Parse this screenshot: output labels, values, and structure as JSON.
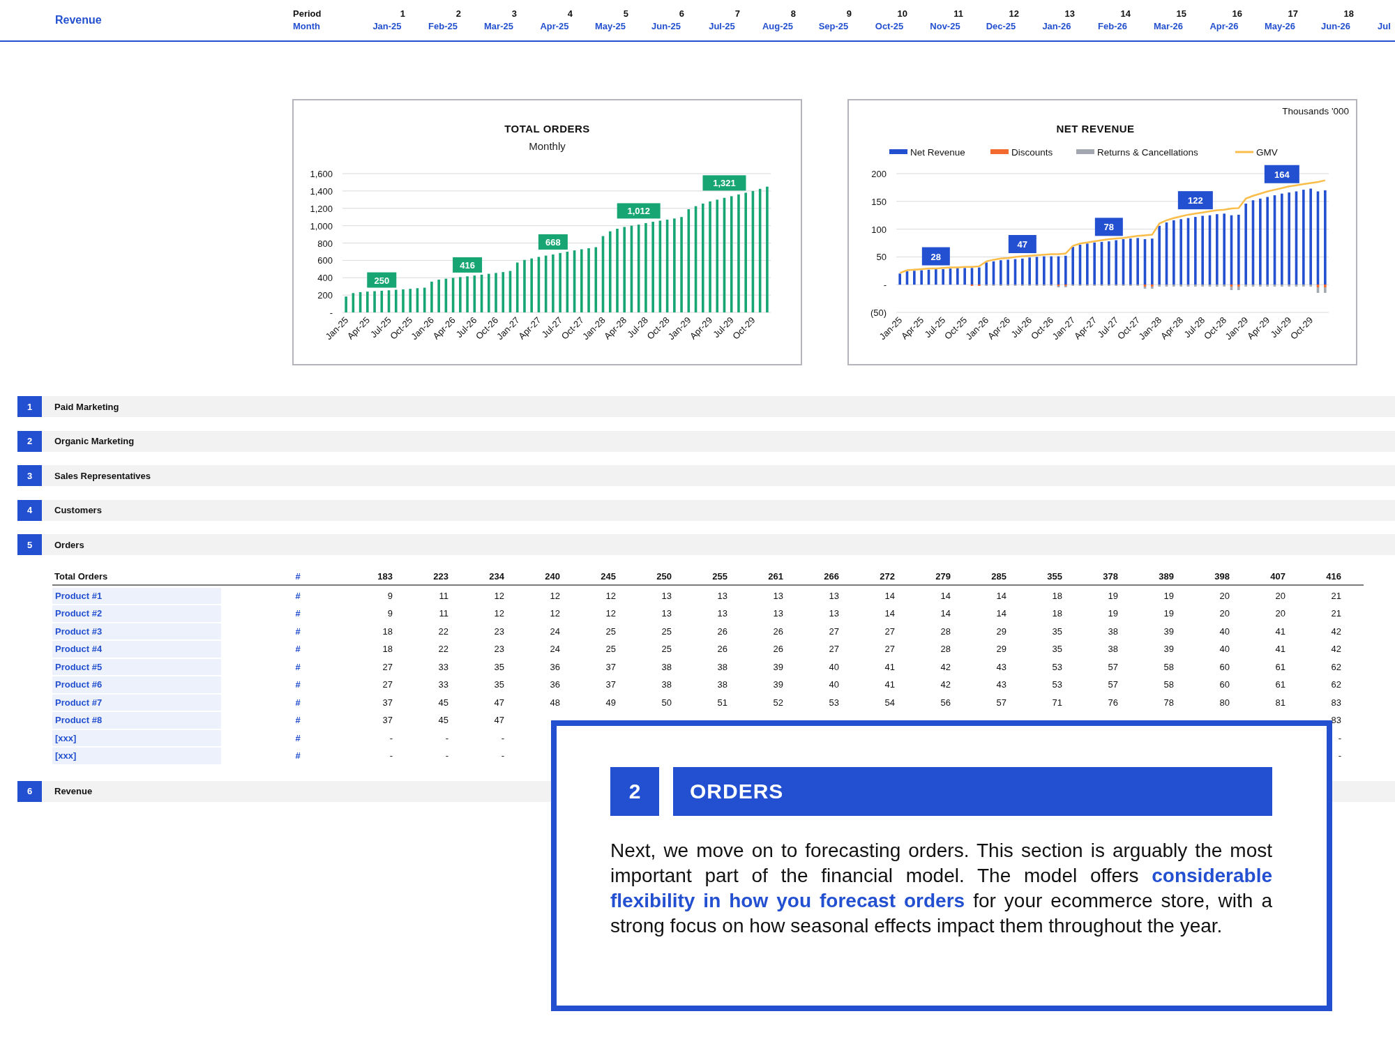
{
  "header": {
    "title": "Revenue",
    "period_label": "Period",
    "month_label": "Month",
    "periods": [
      {
        "number": "1",
        "month": "Jan-25"
      },
      {
        "number": "2",
        "month": "Feb-25"
      },
      {
        "number": "3",
        "month": "Mar-25"
      },
      {
        "number": "4",
        "month": "Apr-25"
      },
      {
        "number": "5",
        "month": "May-25"
      },
      {
        "number": "6",
        "month": "Jun-25"
      },
      {
        "number": "7",
        "month": "Jul-25"
      },
      {
        "number": "8",
        "month": "Aug-25"
      },
      {
        "number": "9",
        "month": "Sep-25"
      },
      {
        "number": "10",
        "month": "Oct-25"
      },
      {
        "number": "11",
        "month": "Nov-25"
      },
      {
        "number": "12",
        "month": "Dec-25"
      },
      {
        "number": "13",
        "month": "Jan-26"
      },
      {
        "number": "14",
        "month": "Feb-26"
      },
      {
        "number": "15",
        "month": "Mar-26"
      },
      {
        "number": "16",
        "month": "Apr-26"
      },
      {
        "number": "17",
        "month": "May-26"
      },
      {
        "number": "18",
        "month": "Jun-26"
      }
    ],
    "cut_month": "Jul"
  },
  "charts": [
    {
      "chart_data": {
        "type": "bar",
        "title": "TOTAL ORDERS",
        "subtitle": "Monthly",
        "grid": true,
        "color": "#17a673",
        "categories": [
          "Jan-25",
          null,
          null,
          "Apr-25",
          null,
          null,
          "Jul-25",
          null,
          null,
          "Oct-25",
          null,
          null,
          "Jan-26",
          null,
          null,
          "Apr-26",
          null,
          null,
          "Jul-26",
          null,
          null,
          "Oct-26",
          null,
          null,
          "Jan-27",
          null,
          null,
          "Apr-27",
          null,
          null,
          "Jul-27",
          null,
          null,
          "Oct-27",
          null,
          null,
          "Jan-28",
          null,
          null,
          "Apr-28",
          null,
          null,
          "Jul-28",
          null,
          null,
          "Oct-28",
          null,
          null,
          "Jan-29",
          null,
          null,
          "Apr-29",
          null,
          null,
          "Jul-29",
          null,
          null,
          "Oct-29",
          null,
          null
        ],
        "values": [
          183,
          223,
          234,
          240,
          245,
          250,
          255,
          261,
          266,
          272,
          279,
          285,
          355,
          378,
          389,
          398,
          407,
          416,
          425,
          435,
          445,
          455,
          465,
          478,
          575,
          605,
          622,
          640,
          655,
          668,
          685,
          700,
          715,
          728,
          740,
          752,
          880,
          935,
          965,
          985,
          1000,
          1012,
          1030,
          1045,
          1058,
          1070,
          1083,
          1100,
          1190,
          1225,
          1255,
          1280,
          1300,
          1321,
          1340,
          1360,
          1380,
          1400,
          1425,
          1450
        ],
        "ylim": [
          0,
          1600
        ],
        "yticks": [
          {
            "value": 0,
            "label": "-"
          },
          {
            "value": 200,
            "label": "200"
          },
          {
            "value": 400,
            "label": "400"
          },
          {
            "value": 600,
            "label": "600"
          },
          {
            "value": 800,
            "label": "800"
          },
          {
            "value": 1000,
            "label": "1,000"
          },
          {
            "value": 1200,
            "label": "1,200"
          },
          {
            "value": 1400,
            "label": "1,400"
          },
          {
            "value": 1600,
            "label": "1,600"
          }
        ],
        "value_labels": [
          null,
          null,
          null,
          null,
          null,
          "250",
          null,
          null,
          null,
          null,
          null,
          null,
          null,
          null,
          null,
          null,
          null,
          "416",
          null,
          null,
          null,
          null,
          null,
          null,
          null,
          null,
          null,
          null,
          null,
          "668",
          null,
          null,
          null,
          null,
          null,
          null,
          null,
          null,
          null,
          null,
          null,
          "1,012",
          null,
          null,
          null,
          null,
          null,
          null,
          null,
          null,
          null,
          null,
          null,
          "1,321",
          null,
          null,
          null,
          null,
          null,
          null
        ]
      }
    },
    {
      "chart_data": {
        "type": "bar",
        "title": "NET REVENUE",
        "ylabel": "Thousands '000",
        "stacked": true,
        "grid": true,
        "legend": true,
        "categories": [
          "Jan-25",
          null,
          null,
          "Apr-25",
          null,
          null,
          "Jul-25",
          null,
          null,
          "Oct-25",
          null,
          null,
          "Jan-26",
          null,
          null,
          "Apr-26",
          null,
          null,
          "Jul-26",
          null,
          null,
          "Oct-26",
          null,
          null,
          "Jan-27",
          null,
          null,
          "Apr-27",
          null,
          null,
          "Jul-27",
          null,
          null,
          "Oct-27",
          null,
          null,
          "Jan-28",
          null,
          null,
          "Apr-28",
          null,
          null,
          "Jul-28",
          null,
          null,
          "Oct-28",
          null,
          null,
          "Jan-29",
          null,
          null,
          "Apr-29",
          null,
          null,
          "Jul-29",
          null,
          null,
          "Oct-29",
          null,
          null
        ],
        "series": [
          {
            "name": "Net Revenue",
            "color": "#2350d0",
            "type": "bar",
            "values": [
              20,
              24,
              25,
              26,
              27,
              28,
              28,
              29,
              30,
              30,
              30,
              31,
              40,
              42,
              44,
              45,
              46,
              47,
              49,
              50,
              51,
              51,
              51,
              52,
              68,
              72,
              74,
              76,
              77,
              78,
              80,
              82,
              83,
              84,
              82,
              83,
              106,
              112,
              116,
              118,
              120,
              122,
              124,
              125,
              127,
              128,
              125,
              126,
              146,
              152,
              155,
              158,
              161,
              164,
              166,
              168,
              171,
              173,
              168,
              170
            ]
          },
          {
            "name": "Discounts",
            "color": "#f26a2e",
            "type": "bar",
            "values": [
              0,
              0,
              0,
              0,
              0,
              0,
              0,
              0,
              0,
              0,
              -1,
              -1,
              0,
              0,
              0,
              0,
              0,
              0,
              0,
              0,
              0,
              0,
              -2,
              -2,
              0,
              0,
              0,
              0,
              0,
              0,
              0,
              0,
              0,
              0,
              -3,
              -3,
              0,
              0,
              0,
              0,
              0,
              0,
              0,
              0,
              0,
              0,
              -4,
              -4,
              0,
              0,
              0,
              0,
              0,
              0,
              0,
              0,
              0,
              0,
              -5,
              -5
            ]
          },
          {
            "name": "Returns & Cancellations",
            "color": "#a3a7b0",
            "type": "bar",
            "values": [
              0,
              0,
              0,
              0,
              0,
              0,
              0,
              0,
              0,
              0,
              0,
              0,
              -1,
              -1,
              -1,
              -1,
              -1,
              -1,
              -1,
              -1,
              -1,
              -1,
              -1,
              -1,
              -2,
              -2,
              -2,
              -2,
              -2,
              -2,
              -2,
              -2,
              -2,
              -2,
              -4,
              -4,
              -3,
              -3,
              -3,
              -3,
              -3,
              -3,
              -3,
              -3,
              -3,
              -3,
              -6,
              -6,
              -4,
              -4,
              -4,
              -4,
              -4,
              -4,
              -4,
              -4,
              -4,
              -4,
              -10,
              -10
            ]
          },
          {
            "name": "GMV",
            "color": "#fbbd4a",
            "type": "line",
            "values": [
              21,
              26,
              27,
              28,
              29,
              29,
              30,
              31,
              31,
              32,
              32,
              33,
              42,
              45,
              47,
              48,
              50,
              51,
              52,
              53,
              54,
              55,
              55,
              56,
              70,
              74,
              76,
              78,
              80,
              82,
              83,
              84,
              86,
              88,
              89,
              90,
              110,
              116,
              120,
              123,
              126,
              128,
              130,
              132,
              134,
              135,
              137,
              138,
              155,
              160,
              164,
              168,
              171,
              174,
              177,
              179,
              181,
              183,
              185,
              188
            ]
          }
        ],
        "ylim": [
          -50,
          200
        ],
        "yticks": [
          {
            "value": -50,
            "label": "(50)"
          },
          {
            "value": 0,
            "label": "-"
          },
          {
            "value": 50,
            "label": "50"
          },
          {
            "value": 100,
            "label": "100"
          },
          {
            "value": 150,
            "label": "150"
          },
          {
            "value": 200,
            "label": "200"
          }
        ],
        "value_labels": [
          null,
          null,
          null,
          null,
          null,
          "28",
          null,
          null,
          null,
          null,
          null,
          null,
          null,
          null,
          null,
          null,
          null,
          "47",
          null,
          null,
          null,
          null,
          null,
          null,
          null,
          null,
          null,
          null,
          null,
          "78",
          null,
          null,
          null,
          null,
          null,
          null,
          null,
          null,
          null,
          null,
          null,
          "122",
          null,
          null,
          null,
          null,
          null,
          null,
          null,
          null,
          null,
          null,
          null,
          "164",
          null,
          null,
          null,
          null,
          null,
          null
        ]
      }
    }
  ],
  "sections": [
    {
      "number": "1",
      "title": "Paid Marketing"
    },
    {
      "number": "2",
      "title": "Organic Marketing"
    },
    {
      "number": "3",
      "title": "Sales Representatives"
    },
    {
      "number": "4",
      "title": "Customers"
    },
    {
      "number": "5",
      "title": "Orders",
      "table": {
        "total": {
          "label": "Total Orders",
          "unit": "#",
          "values": [
            "183",
            "223",
            "234",
            "240",
            "245",
            "250",
            "255",
            "261",
            "266",
            "272",
            "279",
            "285",
            "355",
            "378",
            "389",
            "398",
            "407",
            "416"
          ]
        },
        "rows": [
          {
            "label": "Product #1",
            "unit": "#",
            "values": [
              "9",
              "11",
              "12",
              "12",
              "12",
              "13",
              "13",
              "13",
              "13",
              "14",
              "14",
              "14",
              "18",
              "19",
              "19",
              "20",
              "20",
              "21"
            ]
          },
          {
            "label": "Product #2",
            "unit": "#",
            "values": [
              "9",
              "11",
              "12",
              "12",
              "12",
              "13",
              "13",
              "13",
              "13",
              "14",
              "14",
              "14",
              "18",
              "19",
              "19",
              "20",
              "20",
              "21"
            ]
          },
          {
            "label": "Product #3",
            "unit": "#",
            "values": [
              "18",
              "22",
              "23",
              "24",
              "25",
              "25",
              "26",
              "26",
              "27",
              "27",
              "28",
              "29",
              "35",
              "38",
              "39",
              "40",
              "41",
              "42"
            ]
          },
          {
            "label": "Product #4",
            "unit": "#",
            "values": [
              "18",
              "22",
              "23",
              "24",
              "25",
              "25",
              "26",
              "26",
              "27",
              "27",
              "28",
              "29",
              "35",
              "38",
              "39",
              "40",
              "41",
              "42"
            ]
          },
          {
            "label": "Product #5",
            "unit": "#",
            "values": [
              "27",
              "33",
              "35",
              "36",
              "37",
              "38",
              "38",
              "39",
              "40",
              "41",
              "42",
              "43",
              "53",
              "57",
              "58",
              "60",
              "61",
              "62"
            ]
          },
          {
            "label": "Product #6",
            "unit": "#",
            "values": [
              "27",
              "33",
              "35",
              "36",
              "37",
              "38",
              "38",
              "39",
              "40",
              "41",
              "42",
              "43",
              "53",
              "57",
              "58",
              "60",
              "61",
              "62"
            ]
          },
          {
            "label": "Product #7",
            "unit": "#",
            "values": [
              "37",
              "45",
              "47",
              "48",
              "49",
              "50",
              "51",
              "52",
              "53",
              "54",
              "56",
              "57",
              "71",
              "76",
              "78",
              "80",
              "81",
              "83"
            ]
          },
          {
            "label": "Product #8",
            "unit": "#",
            "values": [
              "37",
              "45",
              "47"
            ],
            "last_value": "83"
          },
          {
            "label": "[xxx]",
            "unit": "#",
            "values": [
              "-",
              "-",
              "-"
            ],
            "last_value": "-"
          },
          {
            "label": "[xxx]",
            "unit": "#",
            "values": [
              "-",
              "-",
              "-"
            ],
            "last_value": "-"
          }
        ]
      }
    },
    {
      "number": "6",
      "title": "Revenue"
    }
  ],
  "callout": {
    "number": "2",
    "title": "ORDERS",
    "text": "Next, we move on to forecasting orders. This section is arguably the most important part of the financial model. The model offers **considerable flexibility in how you forecast orders** for your ecommerce store, with a strong focus on how seasonal effects impact them throughout the year."
  }
}
